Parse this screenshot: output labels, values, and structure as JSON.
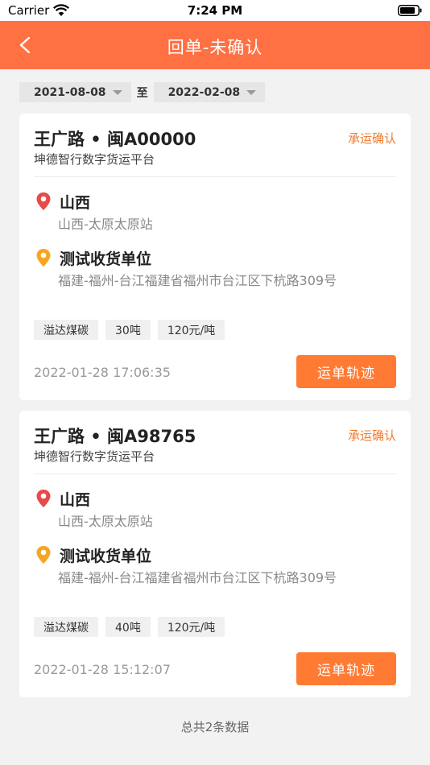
{
  "status_bar": {
    "carrier": "Carrier",
    "time": "7:24 PM"
  },
  "nav": {
    "title": "回单-未确认"
  },
  "filter": {
    "start_date": "2021-08-08",
    "to_label": "至",
    "end_date": "2022-02-08"
  },
  "colors": {
    "accent": "#ff7043",
    "button": "#ff7a33",
    "status_text": "#f07a2e",
    "pin_red": "#e84a4a",
    "pin_orange": "#f5a623"
  },
  "orders": [
    {
      "title": "王广路 • 闽A00000",
      "status": "承运确认",
      "company": "坤德智行数字货运平台",
      "origin": {
        "name": "山西",
        "address": "山西-太原太原站"
      },
      "destination": {
        "name": "测试收货单位",
        "address": "福建-福州-台江福建省福州市台江区下杭路309号"
      },
      "tags": [
        "溢达煤碳",
        "30吨",
        "120元/吨"
      ],
      "time": "2022-01-28 17:06:35",
      "button_label": "运单轨迹"
    },
    {
      "title": "王广路 • 闽A98765",
      "status": "承运确认",
      "company": "坤德智行数字货运平台",
      "origin": {
        "name": "山西",
        "address": "山西-太原太原站"
      },
      "destination": {
        "name": "测试收货单位",
        "address": "福建-福州-台江福建省福州市台江区下杭路309号"
      },
      "tags": [
        "溢达煤碳",
        "40吨",
        "120元/吨"
      ],
      "time": "2022-01-28 15:12:07",
      "button_label": "运单轨迹"
    }
  ],
  "footer": {
    "total_text": "总共2条数据"
  }
}
